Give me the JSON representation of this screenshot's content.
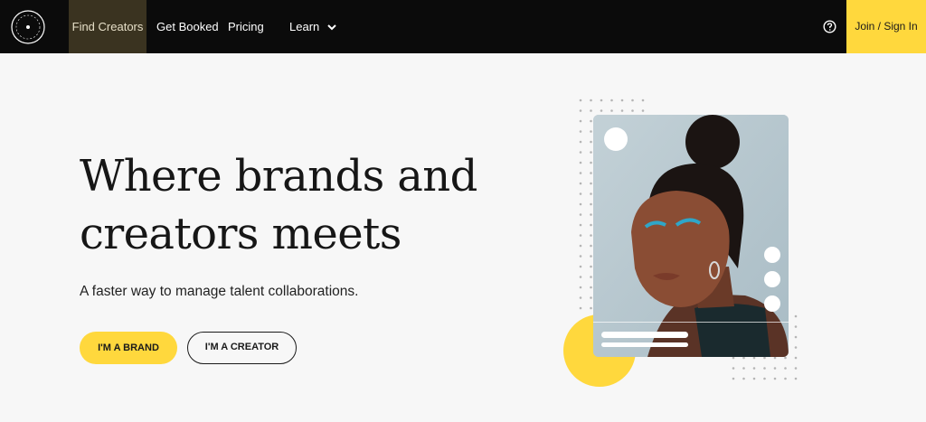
{
  "nav": {
    "items": [
      {
        "label": "Find Creators",
        "active": true
      },
      {
        "label": "Get Booked",
        "active": false
      },
      {
        "label": "Pricing",
        "active": false
      },
      {
        "label": "Learn",
        "active": false,
        "has_dropdown": true
      }
    ],
    "help_icon": "question-circle-icon",
    "join_label": "Join / Sign In"
  },
  "hero": {
    "headline_line1": "Where brands and",
    "headline_line2": "creators meets",
    "subhead": "A faster way to manage talent collaborations.",
    "brand_button": "I'M A BRAND",
    "creator_button": "I'M A CREATOR"
  },
  "colors": {
    "accent": "#ffd83d",
    "nav_bg": "#0b0b0b",
    "page_bg": "#f7f7f7"
  }
}
